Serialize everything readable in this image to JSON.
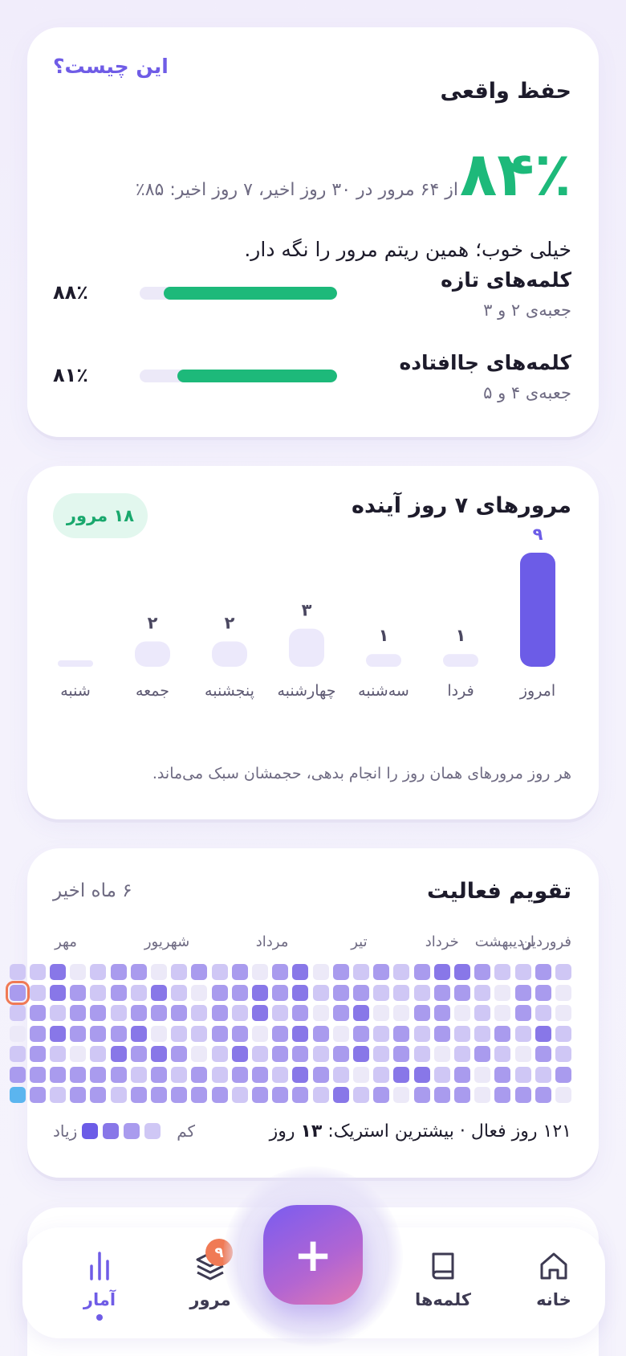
{
  "retention": {
    "title": "حفظ واقعی",
    "what_link": "این چیست؟",
    "percent": "۸۴٪",
    "subtitle": "از ۶۴ مرور در ۳۰ روز اخیر، ۷ روز اخیر: ۸۵٪",
    "message": "خیلی خوب؛ همین ریتم مرور را نگه دار.",
    "rows": [
      {
        "title": "کلمه‌های تازه",
        "sub": "جعبه‌ی ۲ و ۳",
        "pct_label": "۸۸٪",
        "value": 0.88
      },
      {
        "title": "کلمه‌های جاافتاده",
        "sub": "جعبه‌ی ۴ و ۵",
        "pct_label": "۸۱٪",
        "value": 0.81
      }
    ],
    "accent": "#1db97a"
  },
  "forecast": {
    "title": "مرورهای ۷ روز آینده",
    "badge": "۱۸ مرور",
    "note": "هر روز مرورهای همان روز را انجام بدهی، حجمشان سبک می‌ماند."
  },
  "chart_data": {
    "type": "bar",
    "title": "مرورهای ۷ روز آینده",
    "categories": [
      "امروز",
      "فردا",
      "سه‌شنبه",
      "چهارشنبه",
      "پنجشنبه",
      "جمعه",
      "شنبه"
    ],
    "values": [
      9,
      1,
      1,
      3,
      2,
      2,
      0
    ],
    "value_labels": [
      "۹",
      "۱",
      "۱",
      "۳",
      "۲",
      "۲",
      ""
    ],
    "highlight_color": "#6c5ce7",
    "bar_color": "#ece9fb",
    "ylim": [
      0,
      9
    ]
  },
  "activity": {
    "title": "تقویم فعالیت",
    "range": "۶ ماه اخیر",
    "months": [
      "فروردین",
      "اردیبهشت",
      "خرداد",
      "تیر",
      "مرداد",
      "شهریور",
      "مهر"
    ],
    "summary_prefix": "۱۲۱ روز فعال · بیشترین استریک:",
    "summary_value": "۱۳",
    "summary_suffix": "روز",
    "legend_less": "کم",
    "legend_more": "زیاد",
    "levels": [
      "#ece9f8",
      "#cfc7f5",
      "#a99bee",
      "#8877e8",
      "#6c5ce7"
    ],
    "today_color": "#5bb5ef",
    "selected_outline": "#f07a55",
    "weeks": [
      [
        1,
        0,
        0,
        1,
        1,
        2,
        0
      ],
      [
        2,
        2,
        1,
        3,
        2,
        1,
        2
      ],
      [
        1,
        2,
        2,
        1,
        0,
        1,
        2
      ],
      [
        1,
        0,
        0,
        2,
        1,
        2,
        2
      ],
      [
        2,
        1,
        1,
        1,
        2,
        0,
        0
      ],
      [
        3,
        2,
        0,
        1,
        1,
        2,
        2
      ],
      [
        3,
        2,
        2,
        2,
        0,
        1,
        2
      ],
      [
        2,
        1,
        2,
        1,
        1,
        3,
        2
      ],
      [
        1,
        1,
        0,
        2,
        2,
        3,
        0
      ],
      [
        2,
        1,
        0,
        1,
        1,
        1,
        2
      ],
      [
        1,
        2,
        3,
        2,
        3,
        0,
        1
      ],
      [
        2,
        2,
        2,
        0,
        2,
        1,
        3
      ],
      [
        0,
        1,
        0,
        2,
        1,
        2,
        1
      ],
      [
        3,
        3,
        2,
        3,
        2,
        3,
        2
      ],
      [
        2,
        2,
        1,
        2,
        2,
        1,
        2
      ],
      [
        0,
        3,
        3,
        0,
        1,
        2,
        2
      ],
      [
        2,
        2,
        1,
        2,
        3,
        2,
        1
      ],
      [
        1,
        2,
        2,
        2,
        1,
        1,
        2
      ],
      [
        2,
        0,
        1,
        1,
        0,
        2,
        2
      ],
      [
        1,
        1,
        2,
        1,
        2,
        1,
        2
      ],
      [
        0,
        3,
        2,
        0,
        3,
        2,
        2
      ],
      [
        2,
        1,
        2,
        3,
        2,
        1,
        2
      ],
      [
        2,
        2,
        1,
        2,
        3,
        2,
        1
      ],
      [
        1,
        1,
        2,
        2,
        1,
        2,
        2
      ],
      [
        0,
        2,
        2,
        2,
        0,
        2,
        2
      ],
      [
        3,
        3,
        1,
        3,
        1,
        2,
        1
      ],
      [
        1,
        1,
        2,
        2,
        2,
        2,
        2
      ],
      [
        1,
        2,
        1,
        0,
        1,
        2,
        1
      ]
    ],
    "selected_week": 0,
    "selected_day": 1
  },
  "nav": {
    "items": [
      {
        "id": "home",
        "label": "خانه",
        "icon": "home-icon"
      },
      {
        "id": "words",
        "label": "کلمه‌ها",
        "icon": "book-icon"
      },
      {
        "id": "review",
        "label": "مرور",
        "icon": "layers-icon",
        "badge": "۹"
      },
      {
        "id": "stats",
        "label": "آمار",
        "icon": "bar-chart-icon",
        "active": true
      }
    ],
    "fab_label": "+"
  }
}
